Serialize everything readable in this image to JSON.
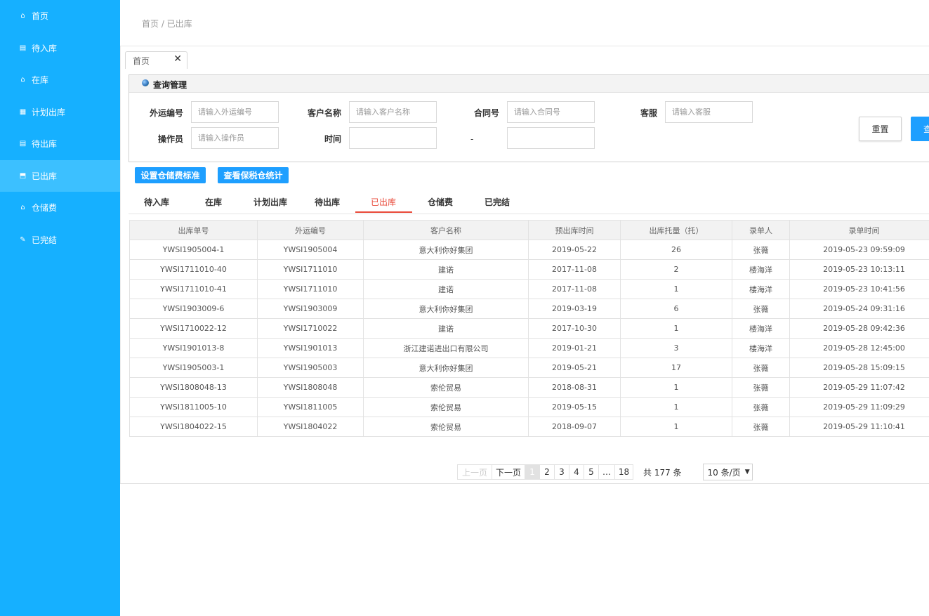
{
  "sidebar": {
    "items": [
      {
        "label": "首页",
        "icon": "home-icon",
        "glyph": "⌂"
      },
      {
        "label": "待入库",
        "icon": "inbox-icon",
        "glyph": "▤"
      },
      {
        "label": "在库",
        "icon": "warehouse-icon",
        "glyph": "⌂"
      },
      {
        "label": "计划出库",
        "icon": "document-icon",
        "glyph": "▦"
      },
      {
        "label": "待出库",
        "icon": "calendar-icon",
        "glyph": "▤"
      },
      {
        "label": "已出库",
        "icon": "outbox-icon",
        "glyph": "⬒"
      },
      {
        "label": "仓储费",
        "icon": "storage-icon",
        "glyph": "⌂"
      },
      {
        "label": "已完结",
        "icon": "edit-icon",
        "glyph": "✎"
      }
    ],
    "active_index": 5,
    "bg_color": "#16b0ff"
  },
  "breadcrumb": "首页 / 已出库",
  "tab": {
    "label": "首页",
    "close": "✕"
  },
  "query_panel": {
    "title": "查询管理",
    "fields": {
      "shipping_no": {
        "label": "外运编号",
        "placeholder": "请输入外运编号"
      },
      "customer": {
        "label": "客户名称",
        "placeholder": "请输入客户名称"
      },
      "contract": {
        "label": "合同号",
        "placeholder": "请输入合同号"
      },
      "service": {
        "label": "客服",
        "placeholder": "请输入客服"
      },
      "operator": {
        "label": "操作员",
        "placeholder": "请输入操作员"
      },
      "time": {
        "label": "时间",
        "separator": "-"
      }
    },
    "reset_label": "重置",
    "query_label": "查询"
  },
  "actions": {
    "set_storage_fee": "设置仓储费标准",
    "view_bonded_stats": "查看保税仓统计"
  },
  "status_tabs": [
    "待入库",
    "在库",
    "计划出库",
    "待出库",
    "已出库",
    "仓储费",
    "已完结"
  ],
  "active_status_tab": 4,
  "accent_color": "#1e9fff",
  "active_tab_color": "#e94a3a",
  "table": {
    "columns": [
      "出库单号",
      "外运编号",
      "客户名称",
      "预出库时间",
      "出库托量（托）",
      "录单人",
      "录单时间"
    ],
    "rows": [
      [
        "YWSI1905004-1",
        "YWSI1905004",
        "意大利你好集团",
        "2019-05-22",
        "26",
        "张薇",
        "2019-05-23 09:59:09"
      ],
      [
        "YWSI1711010-40",
        "YWSI1711010",
        "建诺",
        "2017-11-08",
        "2",
        "楼海洋",
        "2019-05-23 10:13:11"
      ],
      [
        "YWSI1711010-41",
        "YWSI1711010",
        "建诺",
        "2017-11-08",
        "1",
        "楼海洋",
        "2019-05-23 10:41:56"
      ],
      [
        "YWSI1903009-6",
        "YWSI1903009",
        "意大利你好集团",
        "2019-03-19",
        "6",
        "张薇",
        "2019-05-24 09:31:16"
      ],
      [
        "YWSI1710022-12",
        "YWSI1710022",
        "建诺",
        "2017-10-30",
        "1",
        "楼海洋",
        "2019-05-28 09:42:36"
      ],
      [
        "YWSI1901013-8",
        "YWSI1901013",
        "浙江建诺进出口有限公司",
        "2019-01-21",
        "3",
        "楼海洋",
        "2019-05-28 12:45:00"
      ],
      [
        "YWSI1905003-1",
        "YWSI1905003",
        "意大利你好集团",
        "2019-05-21",
        "17",
        "张薇",
        "2019-05-28 15:09:15"
      ],
      [
        "YWSI1808048-13",
        "YWSI1808048",
        "索伦贸易",
        "2018-08-31",
        "1",
        "张薇",
        "2019-05-29 11:07:42"
      ],
      [
        "YWSI1811005-10",
        "YWSI1811005",
        "索伦贸易",
        "2019-05-15",
        "1",
        "张薇",
        "2019-05-29 11:09:29"
      ],
      [
        "YWSI1804022-15",
        "YWSI1804022",
        "索伦贸易",
        "2018-09-07",
        "1",
        "张薇",
        "2019-05-29 11:10:41"
      ]
    ]
  },
  "pagination": {
    "prev": "上一页",
    "next": "下一页",
    "pages": [
      "1",
      "2",
      "3",
      "4",
      "5",
      "…",
      "18"
    ],
    "current": "1",
    "total": "共 177 条",
    "page_size": "10 条/页"
  }
}
